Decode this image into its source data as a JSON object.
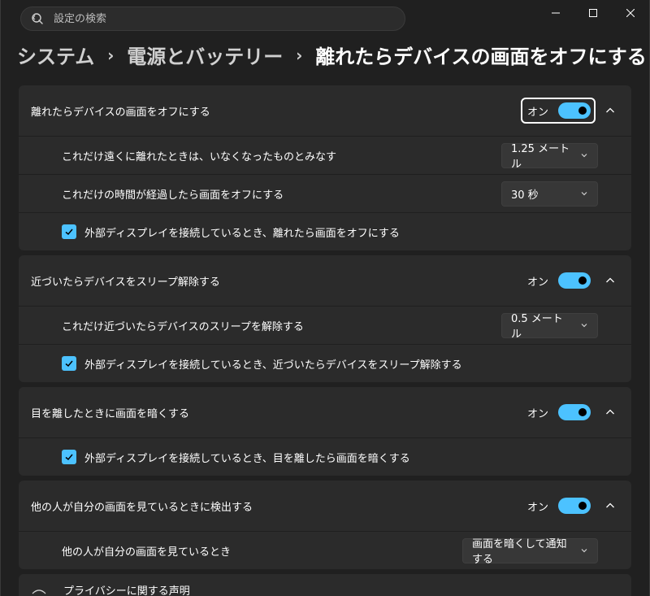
{
  "search": {
    "placeholder": "設定の検索"
  },
  "caption": {
    "minimize_icon": "minimize-icon",
    "maximize_icon": "maximize-icon",
    "close_icon": "close-icon"
  },
  "breadcrumb": {
    "items": [
      "システム",
      "電源とバッテリー",
      "離れたらデバイスの画面をオフにする"
    ],
    "separator": "›"
  },
  "colors": {
    "accent": "#4cc2ff",
    "background": "#202020",
    "card": "#2b2b2b"
  },
  "groups": [
    {
      "title": "離れたらデバイスの画面をオフにする",
      "toggle_label": "オン",
      "toggle_on": true,
      "focused": true,
      "dropdowns": [
        {
          "label": "これだけ遠くに離れたときは、いなくなったものとみなす",
          "value": "1.25 メートル"
        },
        {
          "label": "これだけの時間が経過したら画面をオフにする",
          "value": "30 秒"
        }
      ],
      "checkbox": {
        "label": "外部ディスプレイを接続しているとき、離れたら画面をオフにする",
        "checked": true
      }
    },
    {
      "title": "近づいたらデバイスをスリープ解除する",
      "toggle_label": "オン",
      "toggle_on": true,
      "dropdowns": [
        {
          "label": "これだけ近づいたらデバイスのスリープを解除する",
          "value": "0.5 メートル"
        }
      ],
      "checkbox": {
        "label": "外部ディスプレイを接続しているとき、近づいたらデバイスをスリープ解除する",
        "checked": true
      }
    },
    {
      "title": "目を離したときに画面を暗くする",
      "toggle_label": "オン",
      "toggle_on": true,
      "checkbox": {
        "label": "外部ディスプレイを接続しているとき、目を離したら画面を暗くする",
        "checked": true
      }
    },
    {
      "title": "他の人が自分の画面を見ているときに検出する",
      "toggle_label": "オン",
      "toggle_on": true,
      "dropdowns": [
        {
          "label": "他の人が自分の画面を見ているとき",
          "value": "画面を暗くして通知する"
        }
      ]
    }
  ],
  "partial": {
    "label": "プライバシーに関する声明"
  }
}
